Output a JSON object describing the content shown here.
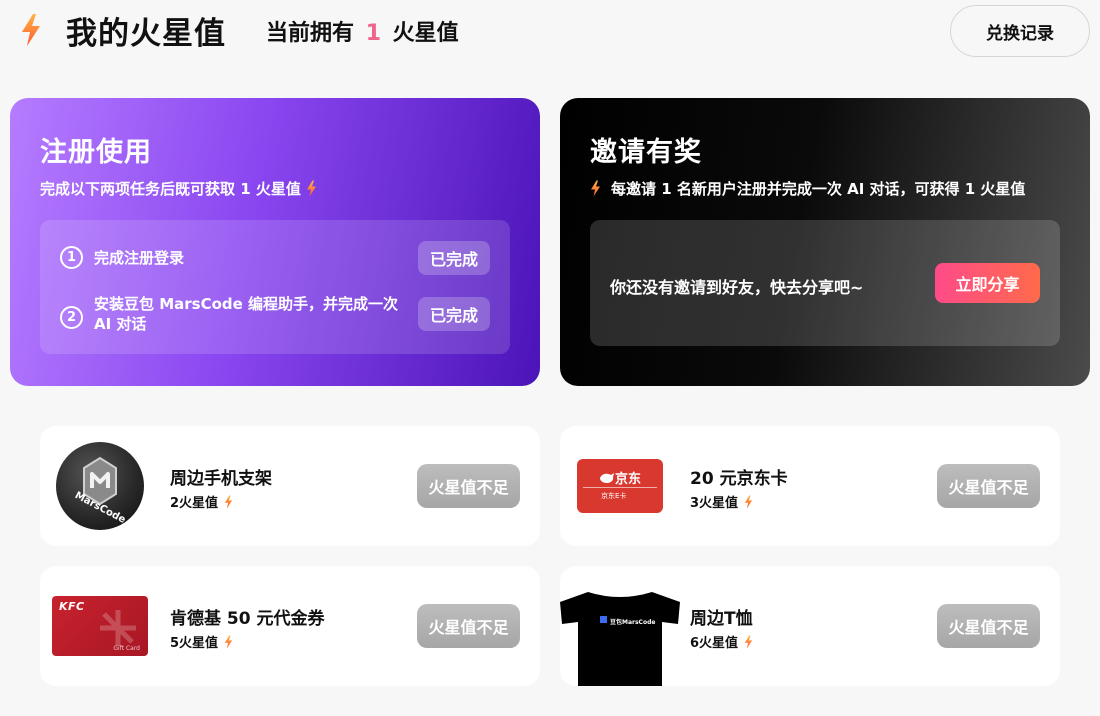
{
  "header": {
    "title": "我的火星值",
    "balance_prefix": "当前拥有",
    "balance_value": "1",
    "balance_suffix": "火星值",
    "history_button": "兑换记录"
  },
  "register_card": {
    "title": "注册使用",
    "subtitle": "完成以下两项任务后既可获取 1 火星值",
    "tasks": [
      {
        "number": "1",
        "text": "完成注册登录",
        "status": "已完成"
      },
      {
        "number": "2",
        "text": "安装豆包 MarsCode 编程助手，并完成一次 AI 对话",
        "status": "已完成"
      }
    ]
  },
  "invite_card": {
    "title": "邀请有奖",
    "subtitle": "每邀请 1 名新用户注册并完成一次 AI 对话，可获得 1 火星值",
    "empty_text": "你还没有邀请到好友，快去分享吧~",
    "share_button": "立即分享"
  },
  "products": [
    {
      "name": "周边手机支架",
      "price": "2火星值",
      "button": "火星值不足",
      "image_text": "MarsCode"
    },
    {
      "name": "20 元京东卡",
      "price": "3火星值",
      "button": "火星值不足",
      "image_text": "京东",
      "image_subtext": "京东E卡"
    },
    {
      "name": "肯德基 50 元代金券",
      "price": "5火星值",
      "button": "火星值不足",
      "image_text": "KFC",
      "image_subtext": "Gift Card"
    },
    {
      "name": "周边T恤",
      "price": "6火星值",
      "button": "火星值不足",
      "image_text": "豆包MarsCode"
    }
  ],
  "colors": {
    "accent_pink": "#f0648c",
    "register_gradient": [
      "#b57cff",
      "#4b14b8"
    ],
    "invite_gradient": [
      "#000000",
      "#4b4b4b"
    ],
    "share_gradient": [
      "#ff4b8a",
      "#ff6a4a"
    ],
    "bolt": "#ff7a30"
  },
  "icons": {
    "header": "lightning-bolt-icon",
    "price": "lightning-bolt-icon"
  }
}
